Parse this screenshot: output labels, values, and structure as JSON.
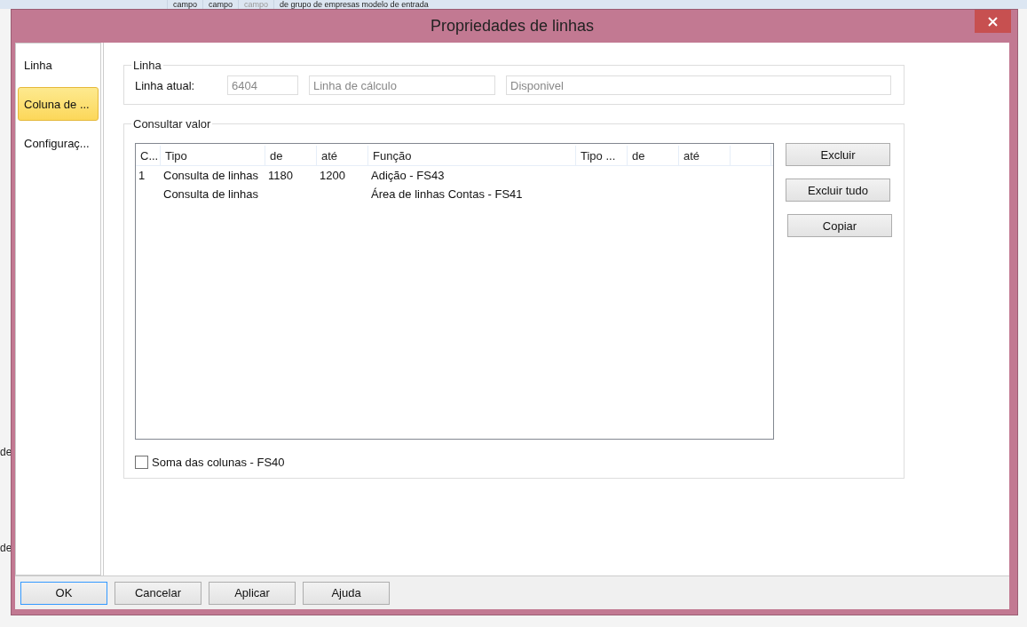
{
  "background_app": {
    "tabs": [
      "campo",
      "campo",
      "campo",
      "de grupo de empresas  modelo de entrada"
    ],
    "tab_disabled": [
      false,
      false,
      true,
      false
    ],
    "left_fragments": [
      "de",
      "de"
    ]
  },
  "window": {
    "title": "Propriedades de linhas"
  },
  "sidebar": {
    "items": [
      {
        "label": "Linha",
        "selected": false
      },
      {
        "label": "Coluna de ...",
        "selected": true
      },
      {
        "label": "Configuraç...",
        "selected": false
      }
    ]
  },
  "linha_group": {
    "title": "Linha",
    "label": "Linha atual:",
    "fields": [
      {
        "value": "6404",
        "disabled": true
      },
      {
        "value": "Linha de cálculo",
        "disabled": true
      },
      {
        "value": "Disponivel",
        "disabled": true
      }
    ]
  },
  "consultar_group": {
    "title": "Consultar valor",
    "table": {
      "columns": [
        "C...",
        "Tipo",
        "de",
        "até",
        "Função",
        "Tipo ...",
        "de",
        "até",
        ""
      ],
      "rows": [
        [
          "1",
          "Consulta de linhas",
          "1180",
          "1200",
          "Adição - FS43",
          "",
          "",
          "",
          ""
        ],
        [
          "",
          "Consulta de linhas",
          "",
          "",
          "Área de linhas Contas - FS41",
          "",
          "",
          "",
          ""
        ]
      ]
    },
    "buttons": [
      {
        "label": "Excluir"
      },
      {
        "label": "Excluir tudo"
      },
      {
        "label": "Copiar"
      }
    ],
    "checkbox": {
      "label": "Soma das colunas - FS40",
      "checked": false
    }
  },
  "footer_buttons": [
    {
      "label": "OK",
      "focused": true
    },
    {
      "label": "Cancelar",
      "focused": false
    },
    {
      "label": "Aplicar",
      "focused": false
    },
    {
      "label": "Ajuda",
      "focused": false
    }
  ]
}
